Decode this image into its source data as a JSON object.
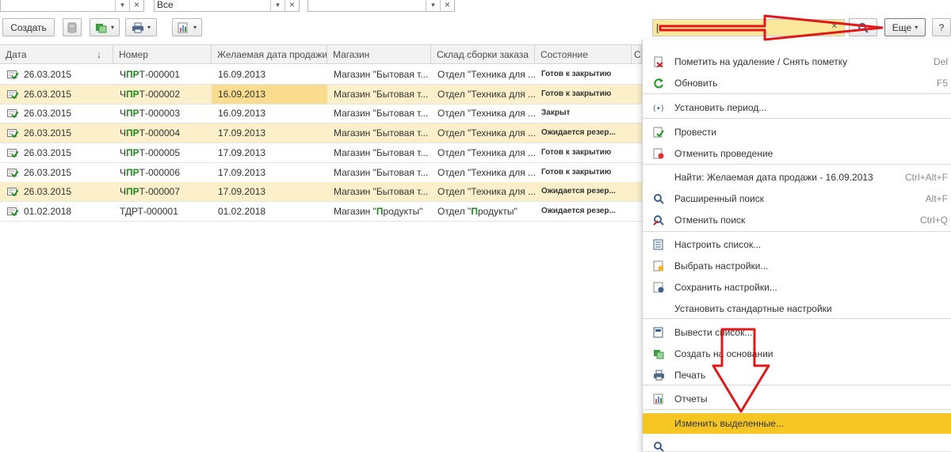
{
  "filters": [
    {
      "value": "",
      "dropdown": "▾",
      "clear": "✕"
    },
    {
      "value": "Все",
      "dropdown": "▾",
      "clear": "✕"
    },
    {
      "value": "",
      "dropdown": "▾",
      "clear": "✕"
    }
  ],
  "toolbar": {
    "create_label": "Создать",
    "more_label": "Еще",
    "help_label": "?",
    "search_value": "[",
    "search_clear": "✕",
    "dropdown_arrow": "▾",
    "sort_arrow": "↓"
  },
  "table": {
    "columns": [
      "Дата",
      "Номер",
      "Желаемая дата продажи",
      "Магазин",
      "Склад сборки заказа",
      "Состояние",
      "С"
    ],
    "rows": [
      {
        "date": "26.03.2015",
        "number": "ЧПРТ-000001",
        "sale_date": "16.09.2013",
        "shop": "Магазин \"Бытовая т...",
        "warehouse": "Отдел \"Техника для ...",
        "state": "Готов к закрытию",
        "highlight": false
      },
      {
        "date": "26.03.2015",
        "number": "ЧПРТ-000002",
        "sale_date": "16.09.2013",
        "shop": "Магазин \"Бытовая т...",
        "warehouse": "Отдел \"Техника для ...",
        "state": "Готов к закрытию",
        "highlight": true
      },
      {
        "date": "26.03.2015",
        "number": "ЧПРТ-000003",
        "sale_date": "16.09.2013",
        "shop": "Магазин \"Бытовая т...",
        "warehouse": "Отдел \"Техника для ...",
        "state": "Закрыт",
        "highlight": false
      },
      {
        "date": "26.03.2015",
        "number": "ЧПРТ-000004",
        "sale_date": "17.09.2013",
        "shop": "Магазин \"Бытовая т...",
        "warehouse": "Отдел \"Техника для ...",
        "state": "Ожидается резер...",
        "highlight": true
      },
      {
        "date": "26.03.2015",
        "number": "ЧПРТ-000005",
        "sale_date": "17.09.2013",
        "shop": "Магазин \"Бытовая т...",
        "warehouse": "Отдел \"Техника для ...",
        "state": "Готов к закрытию",
        "highlight": false
      },
      {
        "date": "26.03.2015",
        "number": "ЧПРТ-000006",
        "sale_date": "17.09.2013",
        "shop": "Магазин \"Бытовая т...",
        "warehouse": "Отдел \"Техника для ...",
        "state": "Готов к закрытию",
        "highlight": false
      },
      {
        "date": "26.03.2015",
        "number": "ЧПРТ-000007",
        "sale_date": "17.09.2013",
        "shop": "Магазин \"Бытовая т...",
        "warehouse": "Отдел \"Техника для ...",
        "state": "Ожидается резер...",
        "highlight": true
      },
      {
        "date": "01.02.2018",
        "number": "ТДРТ-000001",
        "sale_date": "01.02.2018",
        "shop": "Магазин \"Продукты\"",
        "warehouse": "Отдел \"Продукты\"",
        "state": "Ожидается резер...",
        "highlight": false
      }
    ]
  },
  "menu": {
    "items": [
      {
        "label": "Пометить на удаление / Снять пометку",
        "shortcut": "Del",
        "icon": "mark-delete-icon"
      },
      {
        "label": "Обновить",
        "shortcut": "F5",
        "icon": "refresh-icon"
      },
      {
        "label": "Установить период...",
        "shortcut": "",
        "icon": "period-icon"
      },
      {
        "label": "Провести",
        "shortcut": "",
        "icon": "post-icon"
      },
      {
        "label": "Отменить проведение",
        "shortcut": "",
        "icon": "unpost-icon"
      },
      {
        "label": "Найти: Желаемая дата продажи - 16.09.2013",
        "shortcut": "Ctrl+Alt+F",
        "icon": ""
      },
      {
        "label": "Расширенный поиск",
        "shortcut": "Alt+F",
        "icon": "search-icon"
      },
      {
        "label": "Отменить поиск",
        "shortcut": "Ctrl+Q",
        "icon": "cancel-search-icon"
      },
      {
        "label": "Настроить список...",
        "shortcut": "",
        "icon": "list-settings-icon"
      },
      {
        "label": "Выбрать настройки...",
        "shortcut": "",
        "icon": "choose-settings-icon"
      },
      {
        "label": "Сохранить настройки...",
        "shortcut": "",
        "icon": "save-settings-icon"
      },
      {
        "label": "Установить стандартные настройки",
        "shortcut": "",
        "icon": ""
      },
      {
        "label": "Вывести список...",
        "shortcut": "",
        "icon": "export-list-icon"
      },
      {
        "label": "Создать на основании",
        "shortcut": "",
        "icon": "create-based-icon"
      },
      {
        "label": "Печать",
        "shortcut": "",
        "icon": "print-icon"
      },
      {
        "label": "Отчеты",
        "shortcut": "",
        "icon": "reports-icon"
      },
      {
        "label": "Изменить выделенные...",
        "shortcut": "",
        "icon": "",
        "active": true
      }
    ]
  },
  "colors": {
    "row_highlight": "#fbf0c9",
    "selected_cell": "#f9dc8e",
    "menu_active": "#f5c623",
    "search_bg": "#fbe89a",
    "annotation_arrow": "#e01818",
    "number_prefix": "#1d8c1d"
  }
}
